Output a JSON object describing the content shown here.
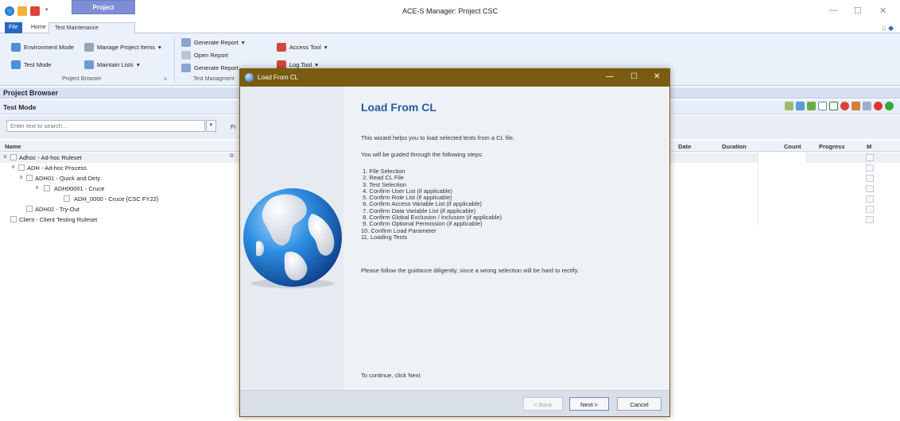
{
  "window": {
    "title": "ACE-S Manager: Project CSC",
    "context_tab": "Project"
  },
  "ribbon_tabs": {
    "file": "File",
    "home": "Home",
    "test_maintenance": "Test Maintenance"
  },
  "ribbon": {
    "environment_mode": "Environment Mode",
    "test_mode": "Test Mode",
    "manage_project_items": "Manage Project Items",
    "maintain_lists": "Maintain Lists",
    "group_project_browser": "Project Browser",
    "generate_report_1": "Generate Report",
    "open_report": "Open Report",
    "generate_report_2": "Generate Report",
    "group_test_management": "Test Managment",
    "access_tool": "Access Tool",
    "log_tool": "Log Tool"
  },
  "project_browser": {
    "title": "Project Browser",
    "mode": "Test Mode",
    "search_placeholder": "Enter text to search...",
    "find_label": "Fi"
  },
  "grid": {
    "columns": {
      "name": "Name",
      "date": "Date",
      "duration": "Duration",
      "count": "Count",
      "progress": "Progress",
      "m": "M"
    },
    "rows": [
      {
        "label": "Adhoc - Ad-hoc Ruleset"
      },
      {
        "label": "ADH - Ad-hoc Process"
      },
      {
        "label": "ADH01 - Quick and Dirty"
      },
      {
        "label": "ADH00001 - Cruce"
      },
      {
        "label": "ADH_0000 - Cruce {CSC FY22}"
      },
      {
        "label": "ADH02 - Try-Out"
      },
      {
        "label": "Client - Client Testing Ruleset"
      }
    ]
  },
  "dialog": {
    "title": "Load From CL",
    "heading": "Load From CL",
    "intro": "This wizard helps you to load selected tests from a CL file.",
    "guided": "You will be guided through the following steps:",
    "steps": [
      " 1. File Selection",
      " 2. Read CL File",
      " 3. Test Selection",
      " 4. Confirm User List (if applicable)",
      " 5. Confirm Role List (if applicable)",
      " 6. Confirm Access Variable List (if applicable)",
      " 7. Confirm Data Variable List (if applicable)",
      " 8. Confirm Global Exclusion / Inclusion (if applicable)",
      " 9. Confirm Optional Permission (if applicable)",
      "10. Confirm Load Parameter",
      "11. Loading Tests"
    ],
    "guidance": "Please follow the guidance diligently, since a wrong selection will be hard to rectify.",
    "continue": "To continue, click Next",
    "back": "< Back",
    "next": "Next >",
    "cancel": "Cancel"
  },
  "colors": {
    "dialog_titlebar": "#7a5c10",
    "heading": "#2b5aa3",
    "file_tab": "#2a67c5"
  }
}
